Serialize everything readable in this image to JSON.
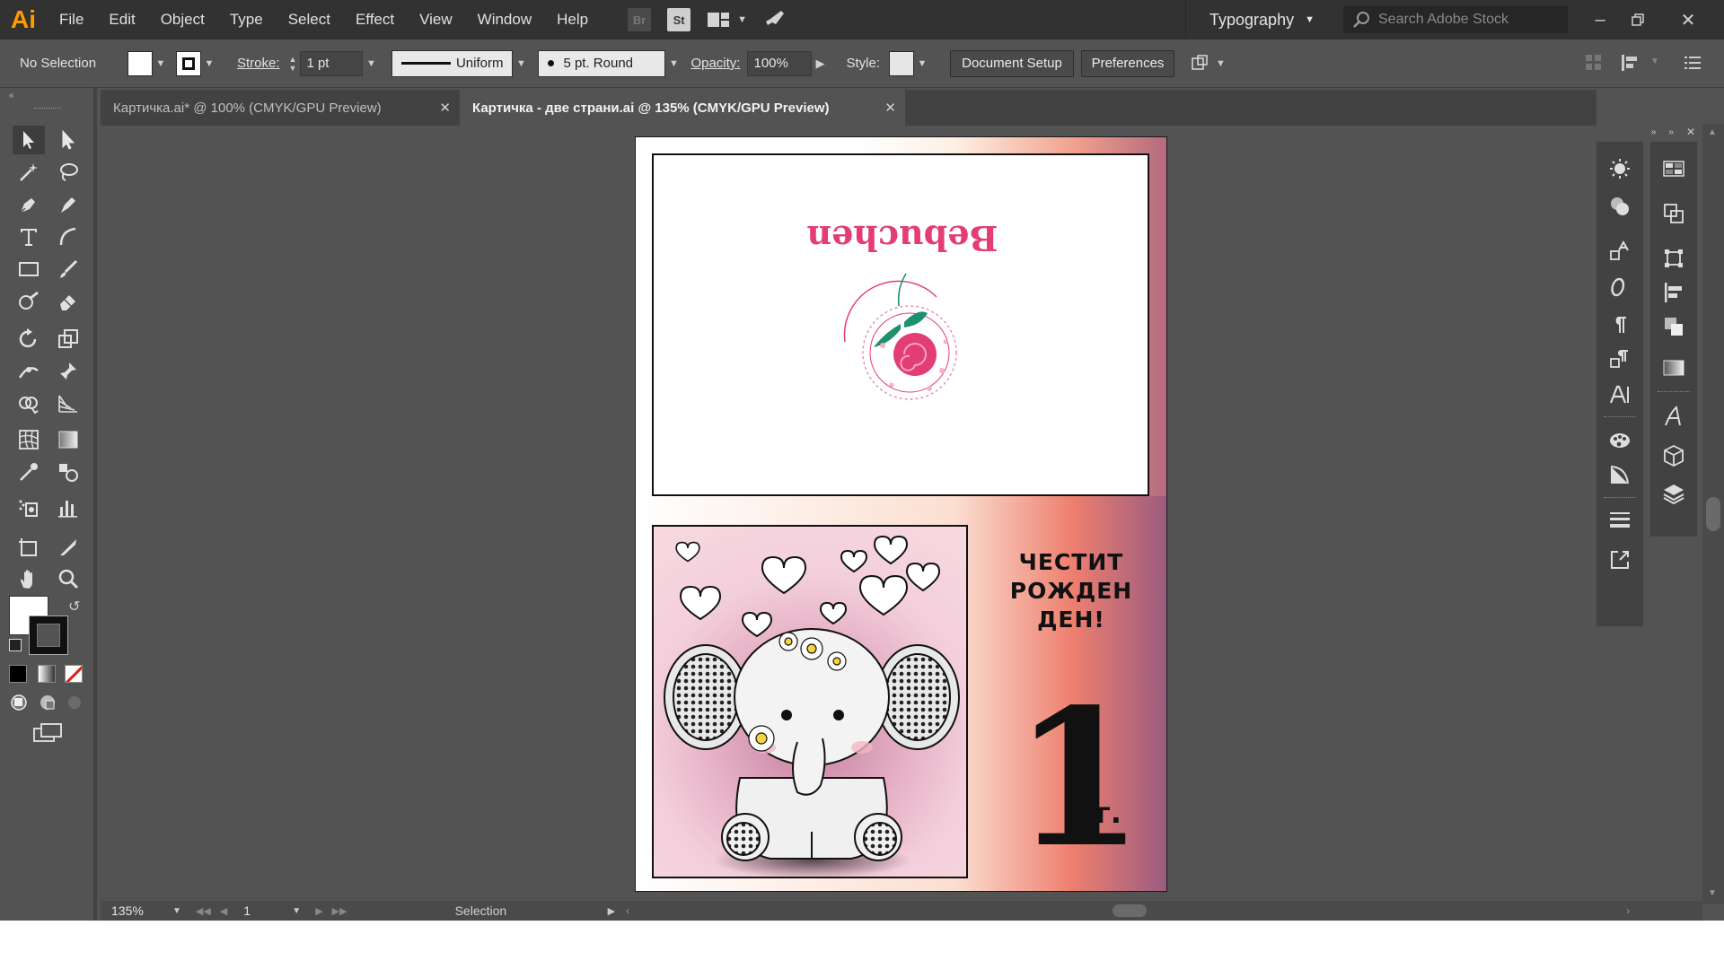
{
  "app": {
    "logo": "Ai",
    "menu": [
      "File",
      "Edit",
      "Object",
      "Type",
      "Select",
      "Effect",
      "View",
      "Window",
      "Help"
    ],
    "bridge_badge": "Br",
    "stock_badge": "St",
    "workspace": "Typography",
    "search_placeholder": "Search Adobe Stock"
  },
  "controlbar": {
    "selection": "No Selection",
    "stroke_label": "Stroke:",
    "stroke_weight": "1 pt",
    "profile": "Uniform",
    "brush": "5 pt. Round",
    "opacity_label": "Opacity:",
    "opacity": "100%",
    "style_label": "Style:",
    "document_setup": "Document Setup",
    "preferences": "Preferences"
  },
  "tabs": [
    {
      "label": "Картичка.ai* @ 100% (CMYK/GPU Preview)",
      "active": false
    },
    {
      "label": "Картичка - две страни.ai @ 135% (CMYK/GPU Preview)",
      "active": true
    }
  ],
  "artboard": {
    "brand": "Bebuchen",
    "greeting_line1": "ЧЕСТИТ",
    "greeting_line2": "РОЖДЕН ДЕН!",
    "age": "1",
    "age_unit": "г."
  },
  "statusbar": {
    "zoom": "135%",
    "artboard_number": "1",
    "tool": "Selection"
  },
  "colors": {
    "accent_pink": "#e23d75",
    "leaf_green": "#1e8f6f",
    "ui_bg": "#535353",
    "menubar_bg": "#323232"
  }
}
